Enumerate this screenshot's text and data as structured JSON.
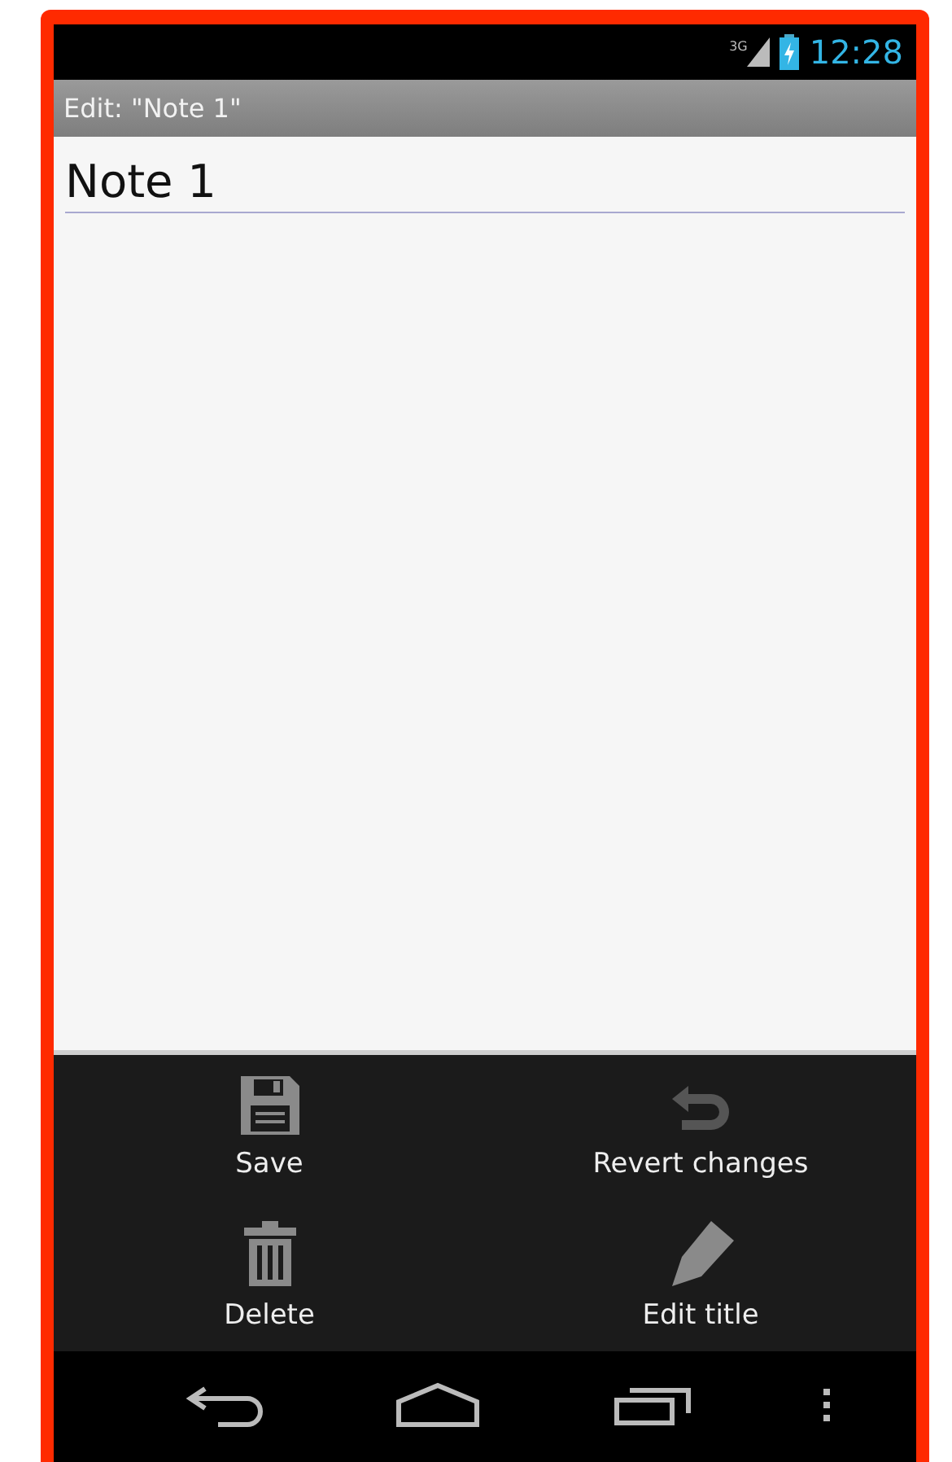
{
  "status_bar": {
    "network": "3G",
    "time": "12:28"
  },
  "title_bar": {
    "title": "Edit: \"Note 1\""
  },
  "editor": {
    "value": "Note 1"
  },
  "menu": [
    {
      "label": "Save"
    },
    {
      "label": "Revert changes"
    },
    {
      "label": "Delete"
    },
    {
      "label": "Edit title"
    }
  ]
}
